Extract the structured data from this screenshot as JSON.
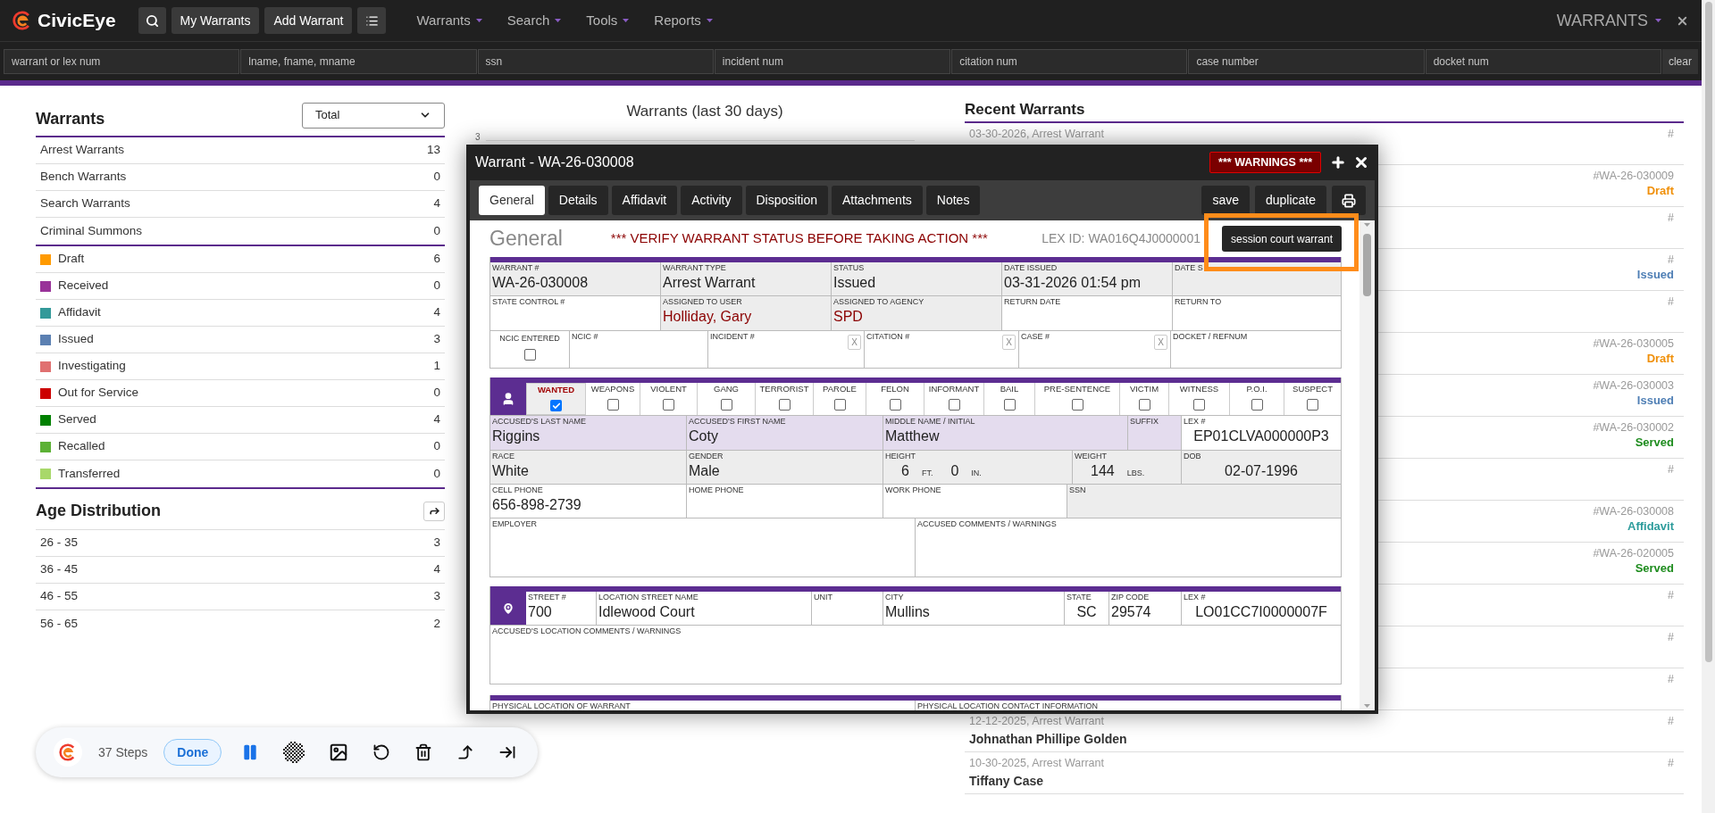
{
  "app": {
    "name": "CivicEye"
  },
  "toolbar_buttons": [
    "My Warrants",
    "Add Warrant"
  ],
  "menus": [
    "Warrants",
    "Search",
    "Tools",
    "Reports"
  ],
  "module_menu": "WARRANTS",
  "search_fields": [
    {
      "placeholder": "warrant or lex num"
    },
    {
      "placeholder": "lname, fname, mname"
    },
    {
      "placeholder": "ssn"
    },
    {
      "placeholder": "incident num"
    },
    {
      "placeholder": "citation num"
    },
    {
      "placeholder": "case number"
    },
    {
      "placeholder": "docket num"
    }
  ],
  "clear_button": "clear",
  "warrant_summary": {
    "title": "Warrants",
    "filter": "Total",
    "types": [
      {
        "label": "Arrest Warrants",
        "count": "13"
      },
      {
        "label": "Bench Warrants",
        "count": "0"
      },
      {
        "label": "Search Warrants",
        "count": "4"
      },
      {
        "label": "Criminal Summons",
        "count": "0"
      }
    ],
    "statuses": [
      {
        "label": "Draft",
        "count": "6",
        "color": "#ff9a00"
      },
      {
        "label": "Received",
        "count": "0",
        "color": "#993399"
      },
      {
        "label": "Affidavit",
        "count": "4",
        "color": "#339999"
      },
      {
        "label": "Issued",
        "count": "3",
        "color": "#5b80b2"
      },
      {
        "label": "Investigating",
        "count": "1",
        "color": "#e07070"
      },
      {
        "label": "Out for Service",
        "count": "0",
        "color": "#cc0000"
      },
      {
        "label": "Served",
        "count": "4",
        "color": "#008000"
      },
      {
        "label": "Recalled",
        "count": "0",
        "color": "#5cb135"
      },
      {
        "label": "Transferred",
        "count": "0",
        "color": "#a8d86a"
      }
    ]
  },
  "age_distribution": {
    "title": "Age Distribution",
    "rows": [
      {
        "label": "26 - 35",
        "count": "3"
      },
      {
        "label": "36 - 45",
        "count": "4"
      },
      {
        "label": "46 - 55",
        "count": "3"
      },
      {
        "label": "56 - 65",
        "count": "2"
      }
    ]
  },
  "chart": {
    "title": "Warrants (last 30 days)",
    "y_tick": "3"
  },
  "recent_warrants": {
    "title": "Recent Warrants",
    "rows": [
      {
        "date": "03-30-2026, Arrest Warrant",
        "ref": "#"
      },
      {
        "ref": "#WA-26-030009",
        "status": "Draft",
        "color": "#f0900a"
      },
      {
        "ref": "#"
      },
      {
        "ref": "#",
        "status": "Issued",
        "color": "#4f7fb5"
      },
      {
        "ref": "#"
      },
      {
        "ref": "#WA-26-030005",
        "status": "Draft",
        "color": "#f0900a"
      },
      {
        "ref": "#WA-26-030003",
        "status": "Issued",
        "color": "#4f7fb5"
      },
      {
        "ref": "#WA-26-030002",
        "status": "Served",
        "color": "#1e8c1e"
      },
      {
        "ref": "#"
      },
      {
        "ref": "#WA-26-030008",
        "status": "Affidavit",
        "color": "#2e9c9c"
      },
      {
        "ref": "#WA-26-020005",
        "status": "Served",
        "color": "#1e8c1e"
      },
      {
        "ref": "#"
      },
      {
        "ref": "#"
      },
      {
        "ref": "#"
      },
      {
        "date": "12-12-2025, Arrest Warrant",
        "name": "Johnathan Phillipe Golden",
        "ref": "#"
      },
      {
        "date": "10-30-2025, Arrest Warrant",
        "name": "Tiffany Case",
        "ref": "#"
      }
    ]
  },
  "modal": {
    "title": "Warrant - WA-26-030008",
    "warnings": "*** WARNINGS ***",
    "tabs": [
      {
        "label": "General",
        "selected": true
      },
      {
        "label": "Details",
        "selected": false
      },
      {
        "label": "Affidavit",
        "selected": false
      },
      {
        "label": "Activity",
        "selected": false
      },
      {
        "label": "Disposition",
        "selected": false
      },
      {
        "label": "Attachments",
        "selected": false
      },
      {
        "label": "Notes",
        "selected": false
      }
    ],
    "actions": [
      "save",
      "duplicate"
    ],
    "heading": "General",
    "alert": "*** VERIFY WARRANT STATUS BEFORE TAKING ACTION ***",
    "lex_id": "LEX ID: WA016Q4J0000001",
    "court_button": "session court warrant",
    "warrant_rows": [
      [
        {
          "label": "WARRANT #",
          "value": "WA-26-030008",
          "locked": true,
          "tinted": false
        },
        {
          "label": "WARRANT TYPE",
          "value": "Arrest Warrant",
          "locked": true,
          "tinted": false
        },
        {
          "label": "STATUS",
          "value": "Issued",
          "locked": true,
          "tinted": false
        },
        {
          "label": "DATE ISSUED",
          "value": "03-31-2026 01:54 pm",
          "locked": true,
          "tinted": false
        },
        {
          "label": "DATE S",
          "locked": true,
          "tinted": false
        }
      ],
      [
        {
          "label": "STATE CONTROL #",
          "locked": false,
          "tinted": false
        },
        {
          "label": "ASSIGNED TO USER",
          "value": "Holliday, Gary",
          "locked": true,
          "tinted": false,
          "emphasis": true
        },
        {
          "label": "ASSIGNED TO AGENCY",
          "value": "SPD",
          "locked": true,
          "tinted": false,
          "emphasis": true
        },
        {
          "label": "RETURN DATE",
          "locked": false,
          "tinted": false
        },
        {
          "label": "RETURN TO",
          "locked": false,
          "tinted": false
        }
      ],
      [
        {
          "kind": "checkbox",
          "label": "NCIC ENTERED",
          "checked": false,
          "locked": false,
          "tinted": false
        },
        {
          "label": "NCIC #",
          "locked": false,
          "tinted": false
        },
        {
          "label": "INCIDENT #",
          "clear": "X",
          "locked": false,
          "tinted": false
        },
        {
          "label": "CITATION #",
          "clear": "X",
          "locked": false,
          "tinted": false
        },
        {
          "label": "CASE #",
          "clear": "X",
          "locked": false,
          "tinted": false
        },
        {
          "label": "DOCKET / REFNUM",
          "locked": false,
          "tinted": false
        }
      ]
    ],
    "flags": [
      {
        "label": "WANTED",
        "checked": true
      },
      {
        "label": "WEAPONS",
        "checked": false
      },
      {
        "label": "VIOLENT",
        "checked": false
      },
      {
        "label": "GANG",
        "checked": false
      },
      {
        "label": "TERRORIST",
        "checked": false
      },
      {
        "label": "PAROLE",
        "checked": false
      },
      {
        "label": "FELON",
        "checked": false
      },
      {
        "label": "INFORMANT",
        "checked": false
      },
      {
        "label": "BAIL",
        "checked": false
      },
      {
        "label": "PRE-SENTENCE",
        "checked": false
      },
      {
        "label": "VICTIM",
        "checked": false
      },
      {
        "label": "WITNESS",
        "checked": false
      },
      {
        "label": "P.O.I.",
        "checked": false
      },
      {
        "label": "SUSPECT",
        "checked": false
      }
    ],
    "person_rows": [
      [
        {
          "label": "ACCUSED'S LAST NAME",
          "value": "Riggins",
          "locked": false,
          "tinted": true
        },
        {
          "label": "ACCUSED'S FIRST NAME",
          "value": "Coty",
          "locked": false,
          "tinted": true
        },
        {
          "label": "MIDDLE NAME / INITIAL",
          "value": "Matthew",
          "locked": false,
          "tinted": true
        },
        {
          "label": "SUFFIX",
          "locked": false,
          "tinted": true
        },
        {
          "label": "LEX #",
          "value": "EP01CLVA000000P3",
          "locked": false,
          "tinted": false
        }
      ],
      [
        {
          "label": "RACE",
          "value": "White",
          "locked": true,
          "tinted": false
        },
        {
          "label": "GENDER",
          "value": "Male",
          "locked": true,
          "tinted": false
        },
        {
          "kind": "measure",
          "label": "HEIGHT",
          "parts": [
            {
              "value": "6",
              "unit": "FT."
            },
            {
              "value": "0",
              "unit": "IN."
            }
          ],
          "locked": true,
          "tinted": false
        },
        {
          "kind": "measure",
          "label": "WEIGHT",
          "parts": [
            {
              "value": "144",
              "unit": "LBS."
            }
          ],
          "locked": true,
          "tinted": false
        },
        {
          "label": "DOB",
          "value": "02-07-1996",
          "locked": true,
          "tinted": false
        }
      ],
      [
        {
          "label": "CELL PHONE",
          "value": "656-898-2739",
          "locked": false,
          "tinted": false
        },
        {
          "label": "HOME PHONE",
          "locked": false,
          "tinted": false
        },
        {
          "label": "WORK PHONE",
          "locked": false,
          "tinted": false
        },
        {
          "label": "SSN",
          "locked": true,
          "tinted": false
        }
      ],
      [
        {
          "label": "EMPLOYER",
          "locked": false,
          "tinted": false
        },
        {
          "label": "ACCUSED COMMENTS / WARNINGS",
          "locked": false,
          "tinted": false
        }
      ]
    ],
    "location_rows": [
      [
        {
          "label": "STREET #",
          "value": "700",
          "locked": false,
          "tinted": false
        },
        {
          "label": "LOCATION STREET NAME",
          "value": "Idlewood Court",
          "locked": false,
          "tinted": false
        },
        {
          "label": "UNIT",
          "locked": false,
          "tinted": false
        },
        {
          "label": "CITY",
          "value": "Mullins",
          "locked": false,
          "tinted": false
        },
        {
          "label": "STATE",
          "value": "SC",
          "locked": false,
          "tinted": false
        },
        {
          "label": "ZIP CODE",
          "value": "29574",
          "locked": false,
          "tinted": false
        },
        {
          "label": "LEX #",
          "value": "LO01CC7I0000007F",
          "locked": false,
          "tinted": false
        }
      ],
      [
        {
          "label": "ACCUSED'S LOCATION COMMENTS / WARNINGS",
          "locked": false,
          "tinted": false
        }
      ]
    ],
    "physical_rows": [
      [
        {
          "label": "PHYSICAL LOCATION OF WARRANT",
          "locked": false,
          "tinted": false
        },
        {
          "label": "PHYSICAL LOCATION CONTACT INFORMATION",
          "locked": false,
          "tinted": false
        }
      ]
    ]
  },
  "recorder": {
    "steps": "37 Steps",
    "done": "Done"
  }
}
